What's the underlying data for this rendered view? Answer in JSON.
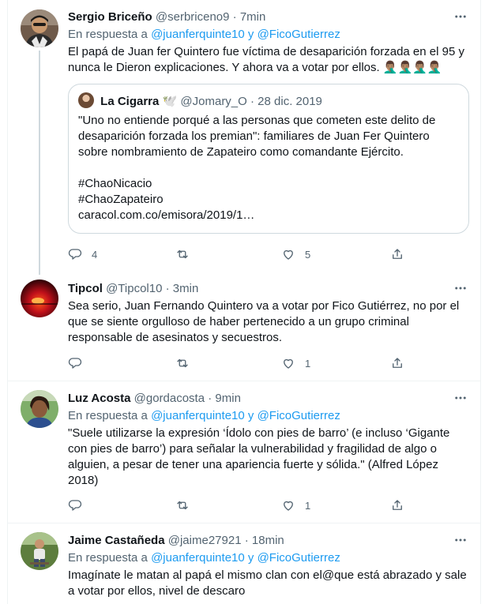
{
  "tweets": [
    {
      "name": "Sergio Briceño",
      "handle": "@serbriceno9",
      "dot": "·",
      "time": "7min",
      "reply_prefix": "En respuesta a",
      "reply_user1": "@juanferquinte10",
      "reply_and": "y",
      "reply_user2": "@FicoGutierrez",
      "text_line1": "El papá de Juan fer Quintero fue víctima de desaparición forzada en el 95 y",
      "text_line2": "nunca le Dieron explicaciones. Y ahora va a votar por ellos. 🤦🏽‍♂️🤦🏽‍♂️🤦🏽‍♂️🤦🏽‍♂️",
      "quote": {
        "name": "La Cigarra",
        "emoji": "🕊️",
        "handle": "@Jomary_O",
        "dot": "·",
        "date": "28 dic. 2019",
        "line1": "\"Uno no entiende porqué a las personas que cometen este delito de",
        "line2": "desaparición forzada los premian\": familiares de Juan Fer Quintero",
        "line3": "sobre nombramiento de Zapateiro como comandante Ejército.",
        "hashtag1": "#ChaoNicacio",
        "hashtag2": "#ChaoZapateiro",
        "link": "caracol.com.co/emisora/2019/1…"
      },
      "reply_count": "4",
      "retweet_count": "",
      "like_count": "5"
    },
    {
      "name": "Tipcol",
      "handle": "@Tipcol10",
      "dot": "·",
      "time": "3min",
      "text_line1": "Sea serio, Juan Fernando Quintero va a votar por Fico Gutiérrez, no por el",
      "text_line2": "que se siente orgulloso de haber pertenecido a un grupo criminal",
      "text_line3": "responsable de asesinatos y secuestros.",
      "reply_count": "",
      "retweet_count": "",
      "like_count": "1"
    },
    {
      "name": "Luz Acosta",
      "handle": "@gordacosta",
      "dot": "·",
      "time": "9min",
      "reply_prefix": "En respuesta a",
      "reply_user1": "@juanferquinte10",
      "reply_and": "y",
      "reply_user2": "@FicoGutierrez",
      "text_line1": "\"Suele utilizarse la expresión ‘Ídolo con pies de barro’ (e incluso ‘Gigante",
      "text_line2": "con pies de barro’) para señalar la vulnerabilidad y fragilidad de algo o",
      "text_line3": "alguien, a pesar de tener una apariencia fuerte y sólida.\" (Alfred López",
      "text_line4": "2018)",
      "reply_count": "",
      "retweet_count": "",
      "like_count": "1"
    },
    {
      "name": "Jaime Castañeda",
      "handle": "@jaime27921",
      "dot": "·",
      "time": "18min",
      "reply_prefix": "En respuesta a",
      "reply_user1": "@juanferquinte10",
      "reply_and": "y",
      "reply_user2": "@FicoGutierrez",
      "text_line1": "Imagínate le matan al papá el mismo clan con el@que está abrazado y sale",
      "text_line2": "a votar por ellos, nivel de descaro"
    }
  ],
  "icons": {
    "reply": "reply-icon",
    "retweet": "retweet-icon",
    "like": "heart-icon",
    "share": "share-icon",
    "more": "more-icon"
  },
  "colors": {
    "link": "#1d9bf0",
    "secondary": "#536471",
    "border": "#eff3f4",
    "thread": "#cfd9de"
  }
}
